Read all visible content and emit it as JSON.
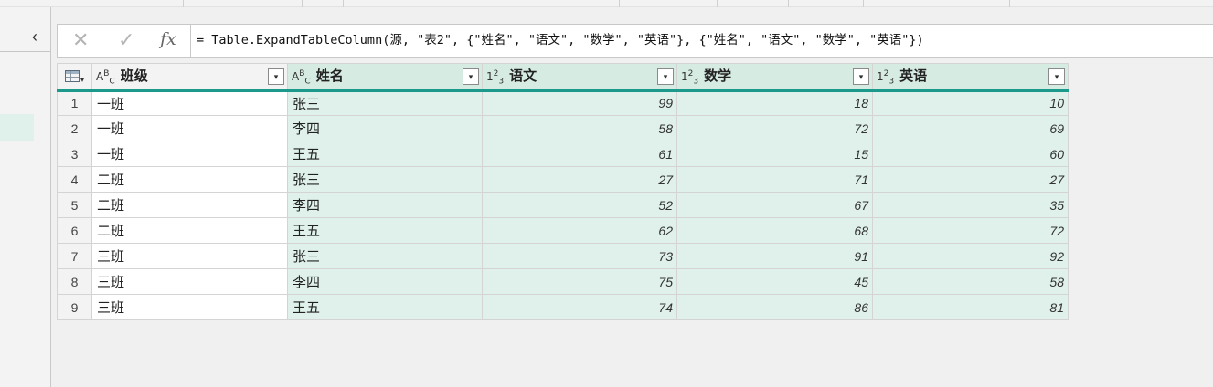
{
  "formula_bar": {
    "cancel_icon": "close-icon",
    "confirm_icon": "check-icon",
    "fx_label": "fx",
    "formula": "= Table.ExpandTableColumn(源, \"表2\", {\"姓名\", \"语文\", \"数学\", \"英语\"}, {\"姓名\", \"语文\", \"数学\", \"英语\"})"
  },
  "colors": {
    "accent": "#1b9a8b",
    "selected_column": "#dff1ea"
  },
  "grid": {
    "columns": [
      {
        "name": "班级",
        "type_icon": "text-type-icon"
      },
      {
        "name": "姓名",
        "type_icon": "text-type-icon"
      },
      {
        "name": "语文",
        "type_icon": "number-type-icon"
      },
      {
        "name": "数学",
        "type_icon": "number-type-icon"
      },
      {
        "name": "英语",
        "type_icon": "number-type-icon"
      }
    ],
    "rows": [
      {
        "n": "1",
        "cells": [
          "一班",
          "张三",
          "99",
          "18",
          "10"
        ]
      },
      {
        "n": "2",
        "cells": [
          "一班",
          "李四",
          "58",
          "72",
          "69"
        ]
      },
      {
        "n": "3",
        "cells": [
          "一班",
          "王五",
          "61",
          "15",
          "60"
        ]
      },
      {
        "n": "4",
        "cells": [
          "二班",
          "张三",
          "27",
          "71",
          "27"
        ]
      },
      {
        "n": "5",
        "cells": [
          "二班",
          "李四",
          "52",
          "67",
          "35"
        ]
      },
      {
        "n": "6",
        "cells": [
          "二班",
          "王五",
          "62",
          "68",
          "72"
        ]
      },
      {
        "n": "7",
        "cells": [
          "三班",
          "张三",
          "73",
          "91",
          "92"
        ]
      },
      {
        "n": "8",
        "cells": [
          "三班",
          "李四",
          "75",
          "45",
          "58"
        ]
      },
      {
        "n": "9",
        "cells": [
          "三班",
          "王五",
          "74",
          "86",
          "81"
        ]
      }
    ]
  }
}
